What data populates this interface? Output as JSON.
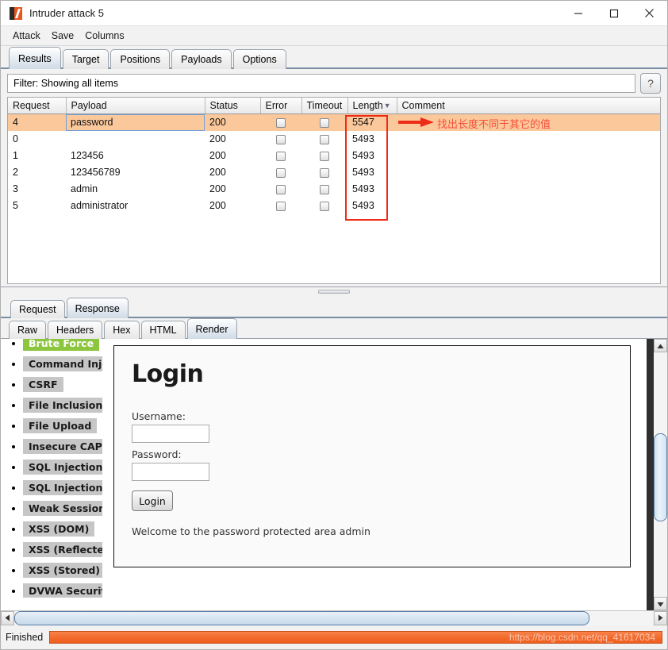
{
  "window": {
    "title": "Intruder attack 5",
    "icon": "burp-suite-icon",
    "controls": {
      "minimize": "minimize-icon",
      "maximize": "maximize-icon",
      "close": "close-icon"
    }
  },
  "menubar": {
    "items": [
      {
        "label": "Attack"
      },
      {
        "label": "Save"
      },
      {
        "label": "Columns"
      }
    ]
  },
  "main_tabs": {
    "active": "Results",
    "items": [
      {
        "label": "Results"
      },
      {
        "label": "Target"
      },
      {
        "label": "Positions"
      },
      {
        "label": "Payloads"
      },
      {
        "label": "Options"
      }
    ]
  },
  "filter": {
    "text": "Filter: Showing all items",
    "help_label": "?"
  },
  "results_table": {
    "columns": [
      "Request",
      "Payload",
      "Status",
      "Error",
      "Timeout",
      "Length",
      "Comment"
    ],
    "sorted_column": "Length",
    "sort_arrow": "▼",
    "rows": [
      {
        "request": "4",
        "payload": "password",
        "status": "200",
        "error": false,
        "timeout": false,
        "length": "5547",
        "comment": "",
        "selected": true
      },
      {
        "request": "0",
        "payload": "",
        "status": "200",
        "error": false,
        "timeout": false,
        "length": "5493",
        "comment": "",
        "selected": false
      },
      {
        "request": "1",
        "payload": "123456",
        "status": "200",
        "error": false,
        "timeout": false,
        "length": "5493",
        "comment": "",
        "selected": false
      },
      {
        "request": "2",
        "payload": "123456789",
        "status": "200",
        "error": false,
        "timeout": false,
        "length": "5493",
        "comment": "",
        "selected": false
      },
      {
        "request": "3",
        "payload": "admin",
        "status": "200",
        "error": false,
        "timeout": false,
        "length": "5493",
        "comment": "",
        "selected": false
      },
      {
        "request": "5",
        "payload": "administrator",
        "status": "200",
        "error": false,
        "timeout": false,
        "length": "5493",
        "comment": "",
        "selected": false
      }
    ],
    "annotation": {
      "text": "找出长度不同于其它的值",
      "color": "#f4503b",
      "box_color": "#ee2b16"
    }
  },
  "message_tabs": {
    "active": "Response",
    "items": [
      {
        "label": "Request"
      },
      {
        "label": "Response"
      }
    ]
  },
  "view_tabs": {
    "active": "Render",
    "items": [
      {
        "label": "Raw"
      },
      {
        "label": "Headers"
      },
      {
        "label": "Hex"
      },
      {
        "label": "HTML"
      },
      {
        "label": "Render"
      }
    ]
  },
  "rendered_page": {
    "sidebar": {
      "active": "Brute Force",
      "items": [
        {
          "label": "Brute Force"
        },
        {
          "label": "Command Inje"
        },
        {
          "label": "CSRF"
        },
        {
          "label": "File Inclusion"
        },
        {
          "label": "File Upload"
        },
        {
          "label": "Insecure CAPT"
        },
        {
          "label": "SQL Injection"
        },
        {
          "label": "SQL Injection ("
        },
        {
          "label": "Weak Session"
        },
        {
          "label": "XSS (DOM)"
        },
        {
          "label": "XSS (Reflected"
        },
        {
          "label": "XSS (Stored)"
        },
        {
          "label": "DVWA Security"
        }
      ]
    },
    "login": {
      "title": "Login",
      "username_label": "Username:",
      "username_value": "",
      "password_label": "Password:",
      "password_value": "",
      "submit_label": "Login",
      "welcome": "Welcome to the password protected area admin"
    }
  },
  "statusbar": {
    "status": "Finished",
    "progress_percent": 100,
    "progress_color": "#ef5f1e",
    "watermark": "https://blog.csdn.net/qq_41617034"
  }
}
